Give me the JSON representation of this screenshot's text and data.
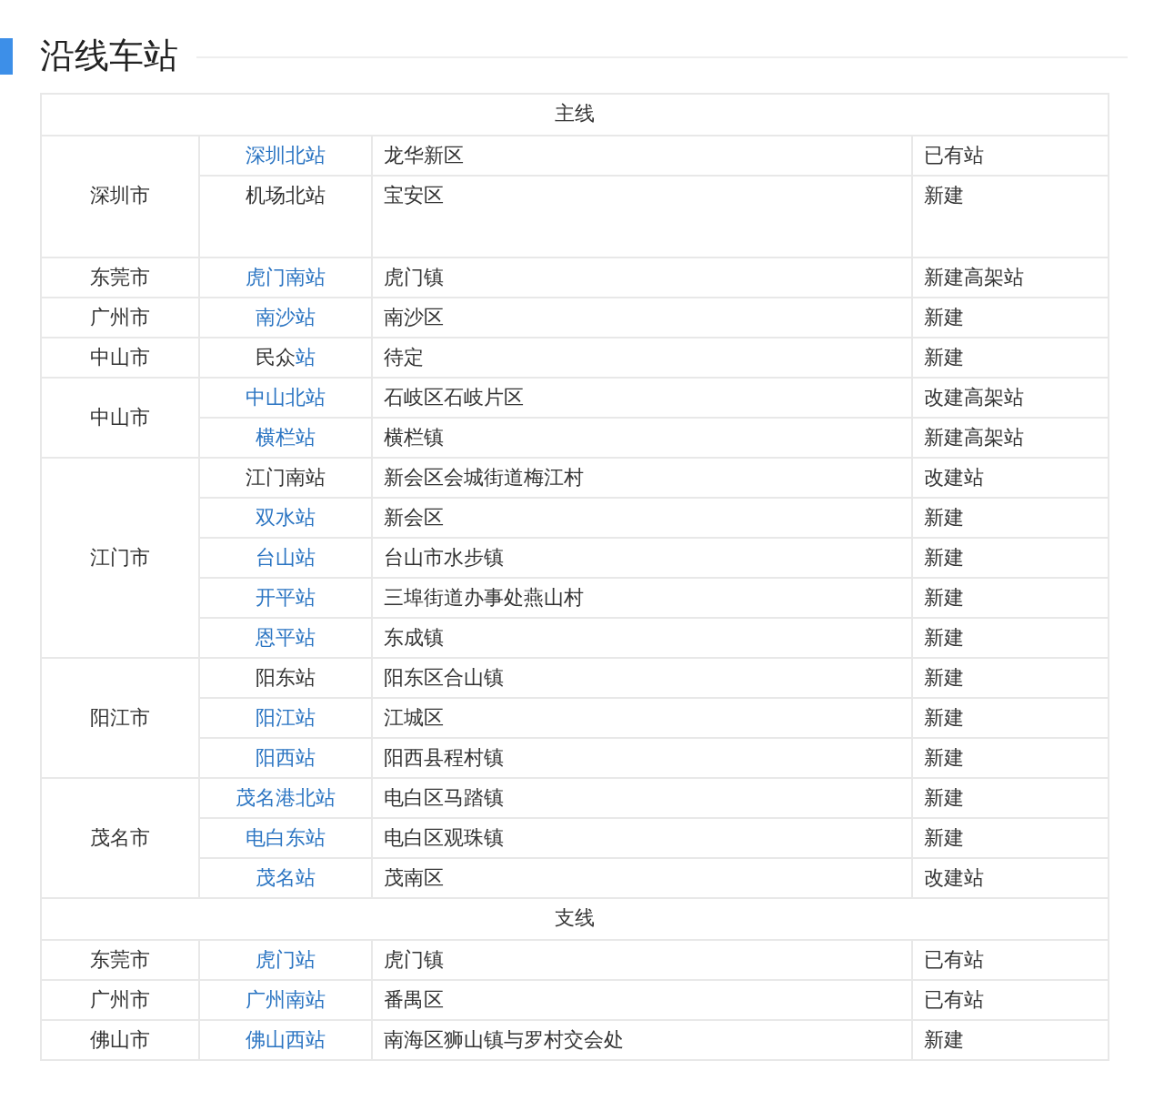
{
  "heading": "沿线车站",
  "sections": [
    {
      "title": "主线",
      "groups": [
        {
          "city": "深圳市",
          "rows": [
            {
              "station": [
                {
                  "text": "深圳北站",
                  "link": true
                }
              ],
              "location": "龙华新区",
              "status": "已有站"
            },
            {
              "station": [
                {
                  "text": "机场北站",
                  "link": false
                }
              ],
              "location": "宝安区",
              "status": "新建"
            }
          ]
        },
        {
          "city": "东莞市",
          "rows": [
            {
              "station": [
                {
                  "text": "虎门南站",
                  "link": true
                }
              ],
              "location": "虎门镇",
              "status": "新建高架站"
            }
          ]
        },
        {
          "city": "广州市",
          "rows": [
            {
              "station": [
                {
                  "text": "南沙站",
                  "link": true
                }
              ],
              "location": "南沙区",
              "status": "新建"
            }
          ]
        },
        {
          "city": "中山市",
          "rows": [
            {
              "station": [
                {
                  "text": "民众",
                  "link": false
                },
                {
                  "text": "站",
                  "link": true
                }
              ],
              "location": "待定",
              "status": "新建"
            }
          ]
        },
        {
          "city": "中山市",
          "rows": [
            {
              "station": [
                {
                  "text": "中山北站",
                  "link": true
                }
              ],
              "location": "石岐区石岐片区",
              "status": "改建高架站"
            },
            {
              "station": [
                {
                  "text": "横栏站",
                  "link": true
                }
              ],
              "location": "横栏镇",
              "status": "新建高架站"
            }
          ]
        },
        {
          "city": "江门市",
          "rows": [
            {
              "station": [
                {
                  "text": "江门南站",
                  "link": false
                }
              ],
              "location": "新会区会城街道梅江村",
              "status": "改建站"
            },
            {
              "station": [
                {
                  "text": "双水站",
                  "link": true
                }
              ],
              "location": "新会区",
              "status": "新建"
            },
            {
              "station": [
                {
                  "text": "台山站",
                  "link": true
                }
              ],
              "location": "台山市水步镇",
              "status": "新建"
            },
            {
              "station": [
                {
                  "text": "开平站",
                  "link": true
                }
              ],
              "location": "三埠街道办事处燕山村",
              "status": "新建"
            },
            {
              "station": [
                {
                  "text": "恩平站",
                  "link": true
                }
              ],
              "location": "东成镇",
              "status": "新建"
            }
          ]
        },
        {
          "city": "阳江市",
          "rows": [
            {
              "station": [
                {
                  "text": "阳东站",
                  "link": false
                }
              ],
              "location": "阳东区合山镇",
              "status": "新建"
            },
            {
              "station": [
                {
                  "text": "阳江站",
                  "link": true
                }
              ],
              "location": "江城区",
              "status": "新建"
            },
            {
              "station": [
                {
                  "text": "阳西站",
                  "link": true
                }
              ],
              "location": "阳西县程村镇",
              "status": "新建"
            }
          ]
        },
        {
          "city": "茂名市",
          "rows": [
            {
              "station": [
                {
                  "text": "茂名港北站",
                  "link": true
                }
              ],
              "location": "电白区马踏镇",
              "status": "新建"
            },
            {
              "station": [
                {
                  "text": "电白东站",
                  "link": true
                }
              ],
              "location": "电白区观珠镇",
              "status": "新建"
            },
            {
              "station": [
                {
                  "text": "茂名站",
                  "link": true
                }
              ],
              "location": "茂南区",
              "status": "改建站"
            }
          ]
        }
      ]
    },
    {
      "title": "支线",
      "groups": [
        {
          "city": "东莞市",
          "rows": [
            {
              "station": [
                {
                  "text": "虎门站",
                  "link": true
                }
              ],
              "location": "虎门镇",
              "status": "已有站"
            }
          ]
        },
        {
          "city": "广州市",
          "rows": [
            {
              "station": [
                {
                  "text": "广州南站",
                  "link": true
                }
              ],
              "location": "番禺区",
              "status": "已有站"
            }
          ]
        },
        {
          "city": "佛山市",
          "rows": [
            {
              "station": [
                {
                  "text": "佛山西站",
                  "link": true
                }
              ],
              "location": "南海区狮山镇与罗村交会处",
              "status": "新建"
            }
          ]
        }
      ]
    }
  ]
}
